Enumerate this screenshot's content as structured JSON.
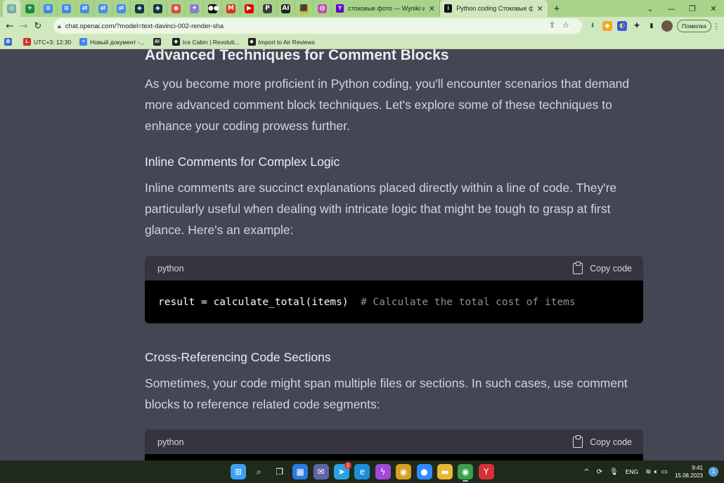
{
  "browser": {
    "pinned_tabs": [
      {
        "icon": "chatgpt-icon",
        "glyph": "◎",
        "color": "#74aa9c"
      },
      {
        "icon": "google-sheets-icon",
        "glyph": "+",
        "color": "#1e8e3e"
      },
      {
        "icon": "google-docs-icon",
        "glyph": "≡",
        "color": "#4285f4"
      },
      {
        "icon": "google-docs-icon",
        "glyph": "≡",
        "color": "#4285f4"
      },
      {
        "icon": "translate-icon",
        "glyph": "⇄",
        "color": "#4a8af4"
      },
      {
        "icon": "translate-icon",
        "glyph": "⇄",
        "color": "#4a8af4"
      },
      {
        "icon": "translate-icon",
        "glyph": "⇄",
        "color": "#4a8af4"
      },
      {
        "icon": "openai-icon",
        "glyph": "◈",
        "color": "#10363f"
      },
      {
        "icon": "openai-icon",
        "glyph": "◈",
        "color": "#10363f"
      },
      {
        "icon": "target-icon",
        "glyph": "◉",
        "color": "#e0443c"
      },
      {
        "icon": "sparkle-icon",
        "glyph": "✦",
        "color": "#8a7bd8"
      },
      {
        "icon": "medium-icon",
        "glyph": "●●",
        "color": "#111111"
      },
      {
        "icon": "gmail-icon",
        "glyph": "M",
        "color": "#d93025"
      },
      {
        "icon": "youtube-icon",
        "glyph": "▶",
        "color": "#e00000"
      },
      {
        "icon": "p-letter-icon",
        "glyph": "P",
        "color": "#3b3b3b"
      },
      {
        "icon": "ai-logo-icon",
        "glyph": "AI",
        "color": "#222222"
      },
      {
        "icon": "gift-icon",
        "glyph": "⬛",
        "color": "#e0b400"
      },
      {
        "icon": "circle-app-icon",
        "glyph": "◍",
        "color": "#c04fb0"
      }
    ],
    "tabs": [
      {
        "title": "стоковые фото — Wyniki wyszuk",
        "icon": "yahoo-icon",
        "glyph": "Y",
        "color": "#6001d2",
        "active": false
      },
      {
        "title": "Python coding Стоковые фото, и",
        "icon": "istock-icon",
        "glyph": "i",
        "color": "#111111",
        "active": true
      }
    ],
    "new_tab_label": "+",
    "window_controls": {
      "tab_search": "⌄",
      "minimize": "—",
      "restore": "❐",
      "close": "✕"
    },
    "url": "chat.openai.com/?model=text-davinci-002-render-sha",
    "error_button_label": "Помилка",
    "bookmarks": [
      {
        "label": "",
        "icon": "settings-puzzle-icon",
        "glyph": "⚙",
        "color": "#3c6ecf"
      },
      {
        "label": "UTC+3: 12:30",
        "icon": "clock-bookmark-icon",
        "glyph": "L",
        "color": "#d03030"
      },
      {
        "label": "Новый документ -...",
        "icon": "docs-bookmark-icon",
        "glyph": "≡",
        "color": "#4285f4"
      },
      {
        "label": "",
        "icon": "ai-bookmark-icon",
        "glyph": "AI",
        "color": "#2f2f2f"
      },
      {
        "label": "Ice Cabin | Revoluti...",
        "icon": "openai-bookmark-icon",
        "glyph": "◈",
        "color": "#202020"
      },
      {
        "label": "Import to Air Reviews",
        "icon": "openai-bookmark-icon",
        "glyph": "◈",
        "color": "#202020"
      }
    ]
  },
  "article": {
    "section_title": "Advanced Techniques for Comment Blocks",
    "intro": "As you become more proficient in Python coding, you'll encounter scenarios that demand more advanced comment block techniques. Let's explore some of these techniques to enhance your coding prowess further.",
    "subsection1_title": "Inline Comments for Complex Logic",
    "subsection1_text": "Inline comments are succinct explanations placed directly within a line of code. They're particularly useful when dealing with intricate logic that might be tough to grasp at first glance. Here's an example:",
    "code1": {
      "language": "python",
      "copy_label": "Copy code",
      "code": "result = calculate_total(items)",
      "comment": "# Calculate the total cost of items"
    },
    "subsection2_title": "Cross-Referencing Code Sections",
    "subsection2_text": "Sometimes, your code might span multiple files or sections. In such cases, use comment blocks to reference related code segments:",
    "code2": {
      "language": "python",
      "copy_label": "Copy code"
    }
  },
  "taskbar": {
    "apps": [
      {
        "icon": "windows-start-icon",
        "glyph": "⊞",
        "color": "#3aa0f0"
      },
      {
        "icon": "search-icon",
        "glyph": "⌕",
        "color": "transparent"
      },
      {
        "icon": "task-view-icon",
        "glyph": "❐",
        "color": "transparent"
      },
      {
        "icon": "widgets-icon",
        "glyph": "▦",
        "color": "#2a7be0"
      },
      {
        "icon": "teams-chat-icon",
        "glyph": "✉",
        "color": "#6264a7"
      },
      {
        "icon": "telegram-icon",
        "glyph": "➤",
        "color": "#2aa3e0",
        "badge": "1"
      },
      {
        "icon": "edge-icon",
        "glyph": "e",
        "color": "#1a8fd8"
      },
      {
        "icon": "messenger-icon",
        "glyph": "ϟ",
        "color": "#a24ad8"
      },
      {
        "icon": "chrome-canary-icon",
        "glyph": "◉",
        "color": "#d8a020"
      },
      {
        "icon": "zoom-icon",
        "glyph": "●",
        "color": "#2d8cff"
      },
      {
        "icon": "file-explorer-icon",
        "glyph": "▬",
        "color": "#e8b830"
      },
      {
        "icon": "chrome-icon",
        "glyph": "◉",
        "color": "#3aa04a",
        "active": true
      },
      {
        "icon": "yandex-browser-icon",
        "glyph": "Y",
        "color": "#d8303a"
      }
    ],
    "tray": {
      "chevron": "^",
      "language": "ENG",
      "time": "9:41",
      "date": "15.08.2023",
      "notifications": "1"
    }
  }
}
